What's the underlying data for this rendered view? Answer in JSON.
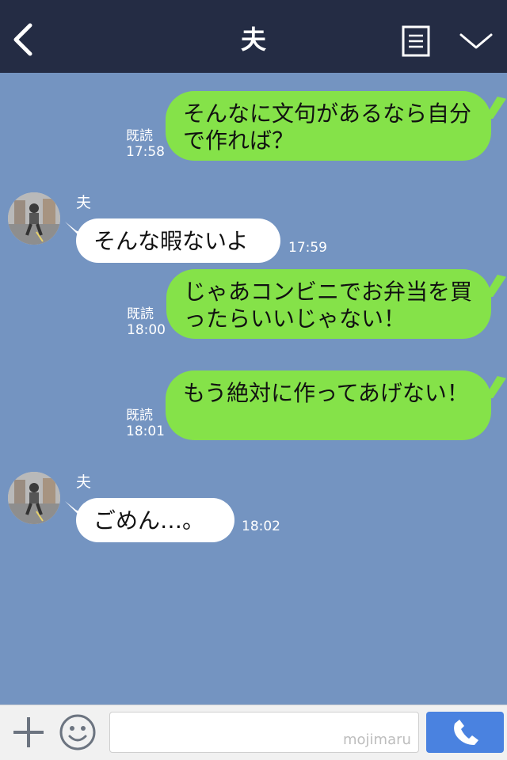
{
  "header": {
    "title": "夫",
    "back_icon": "chevron-left-icon",
    "menu_icon": "memo-icon",
    "collapse_icon": "chevron-down-icon"
  },
  "messages": [
    {
      "side": "me",
      "text": "そんなに文句があるなら自分で作れば？",
      "read": "既読",
      "time": "17:58"
    },
    {
      "side": "them",
      "name": "夫",
      "text": "そんな暇ないよ",
      "time": "17:59"
    },
    {
      "side": "me",
      "text": "じゃあコンビニでお弁当を買ったらいいじゃない！",
      "read": "既読",
      "time": "18:00"
    },
    {
      "side": "me",
      "text": "もう絶対に作ってあげない！",
      "read": "既読",
      "time": "18:01"
    },
    {
      "side": "them",
      "name": "夫",
      "text": "ごめん…。",
      "time": "18:02"
    }
  ],
  "footer": {
    "input_value": "",
    "watermark": "mojimaru",
    "plus_icon": "plus-icon",
    "emoji_icon": "smiley-icon",
    "call_icon": "phone-icon"
  },
  "colors": {
    "header_bg": "#242c44",
    "chat_bg": "#7494c1",
    "my_bubble": "#85e249",
    "their_bubble": "#ffffff",
    "call_button": "#4a82e0"
  }
}
